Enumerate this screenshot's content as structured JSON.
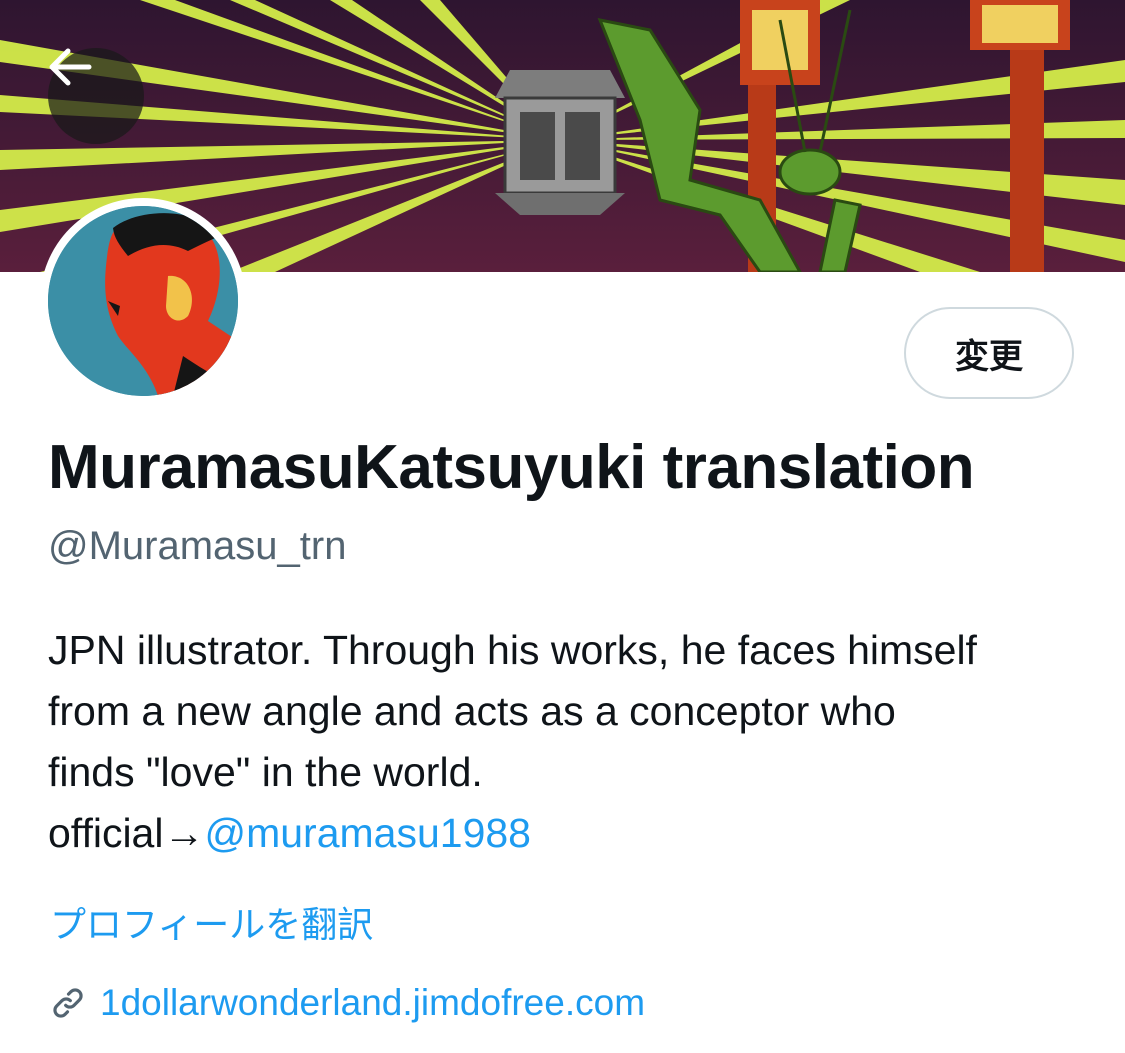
{
  "header": {
    "back_icon": "arrow-left-icon"
  },
  "profile": {
    "edit_button_label": "変更",
    "display_name": "MuramasuKatsuyuki translation",
    "handle": "@Muramasu_trn",
    "bio_line1": "JPN illustrator. Through his works, he faces himself",
    "bio_line2": "from a new angle and acts as a conceptor who",
    "bio_line3": "finds \"love\" in the world.",
    "bio_official_prefix": "official→",
    "bio_official_mention": "@muramasu1988",
    "translate_label": "プロフィールを翻訳",
    "website": "1dollarwonderland.jimdofree.com",
    "website_icon": "link-icon"
  },
  "colors": {
    "accent": "#1d9bf0",
    "text_primary": "#0f1419",
    "text_secondary": "#536471",
    "border": "#cfd9de"
  }
}
